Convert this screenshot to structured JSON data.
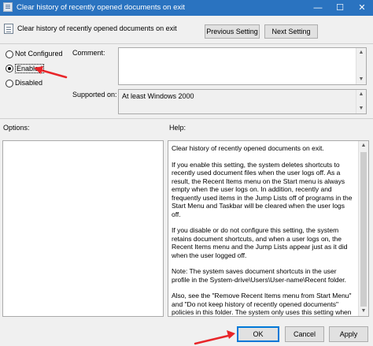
{
  "window": {
    "title": "Clear history of recently opened documents on exit",
    "minimize": "—",
    "maximize": "☐",
    "close": "✕"
  },
  "header": {
    "policy_name": "Clear history of recently opened documents on exit",
    "previous_label": "Previous Setting",
    "next_label": "Next Setting"
  },
  "state": {
    "options": [
      {
        "label": "Not Configured",
        "checked": false
      },
      {
        "label": "Enabled",
        "checked": true
      },
      {
        "label": "Disabled",
        "checked": false
      }
    ]
  },
  "comment": {
    "label": "Comment:",
    "value": ""
  },
  "supported": {
    "label": "Supported on:",
    "value": "At least Windows 2000"
  },
  "options_panel": {
    "label": "Options:"
  },
  "help_panel": {
    "label": "Help:",
    "paragraphs": [
      "Clear history of recently opened documents on exit.",
      "If you enable this setting, the system deletes shortcuts to recently used document files when the user logs off. As a result, the Recent Items menu on the Start menu is always empty when the user logs on. In addition, recently and frequently used items in the Jump Lists off of programs in the Start Menu and Taskbar will be cleared when the user logs off.",
      "If you disable or do not configure this setting, the system retains document shortcuts, and when a user logs on, the Recent Items menu and the Jump Lists appear just as it did when the user logged off.",
      "Note: The system saves document shortcuts in the user profile in the System-drive\\Users\\User-name\\Recent folder.",
      "Also, see the \"Remove Recent Items menu from Start Menu\" and \"Do not keep history of recently opened documents\" policies in this folder. The system only uses this setting when neither of these related settings are selected."
    ]
  },
  "footer": {
    "ok_label": "OK",
    "cancel_label": "Cancel",
    "apply_label": "Apply"
  },
  "colors": {
    "titlebar": "#2a73c0",
    "annotation_arrow": "#e8262a",
    "focus_border": "#0078d7"
  }
}
